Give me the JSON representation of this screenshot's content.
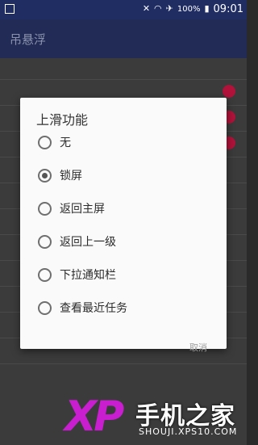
{
  "status_bar": {
    "battery": "100%",
    "time": "09:01"
  },
  "app_bar": {
    "title": "吊悬浮"
  },
  "dialog": {
    "title": "上滑功能",
    "options": [
      {
        "label": "无",
        "selected": false
      },
      {
        "label": "锁屏",
        "selected": true
      },
      {
        "label": "返回主屏",
        "selected": false
      },
      {
        "label": "返回上一级",
        "selected": false
      },
      {
        "label": "下拉通知栏",
        "selected": false
      },
      {
        "label": "查看最近任务",
        "selected": false
      }
    ],
    "cancel_label": "取消"
  },
  "watermark": {
    "brand": "XP",
    "name": "手机之家",
    "url": "SHOUJI.XPS10.COM"
  },
  "colors": {
    "status_bar": "#1f2d63",
    "toggle_on": "#b0123a",
    "dialog_bg": "#fafafa"
  }
}
